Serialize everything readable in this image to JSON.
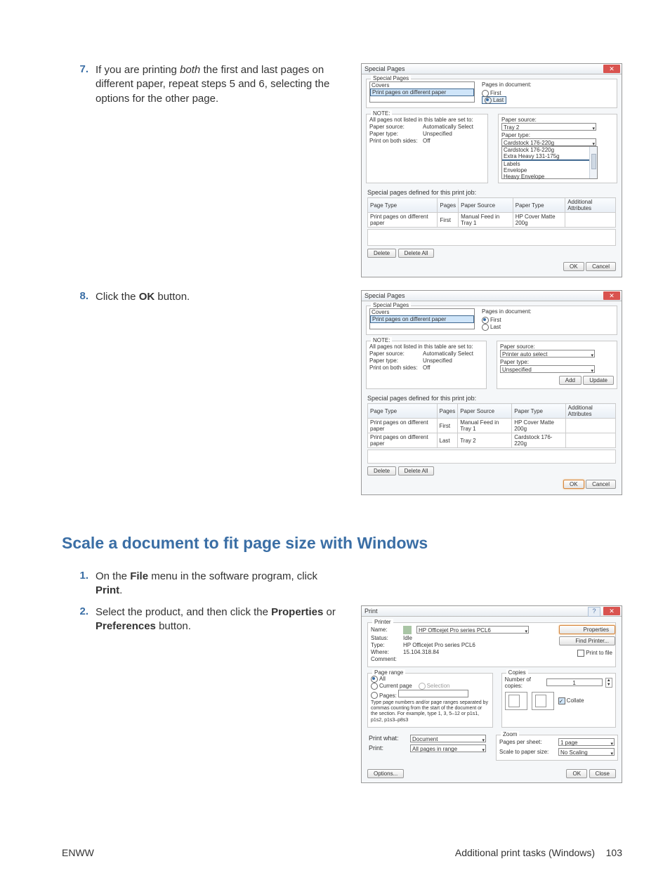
{
  "step7": {
    "num": "7.",
    "text_pre": "If you are printing ",
    "text_em": "both",
    "text_post": " the first and last pages on different paper, repeat steps 5 and 6, selecting the options for the other page."
  },
  "step8": {
    "num": "8.",
    "text_pre": "Click the ",
    "bold": "OK",
    "text_post": " button."
  },
  "section_title": "Scale a document to fit page size with Windows",
  "step1": {
    "num": "1.",
    "p1_pre": "On the ",
    "p1_b1": "File",
    "p1_mid": " menu in the software program, click ",
    "p1_b2": "Print",
    "p1_post": "."
  },
  "step2": {
    "num": "2.",
    "p_pre": "Select the product, and then click the ",
    "p_b1": "Properties",
    "p_mid": " or ",
    "p_b2": "Preferences",
    "p_post": " button."
  },
  "footer_left": "ENWW",
  "footer_right_text": "Additional print tasks (Windows)",
  "footer_page": "103",
  "dlg7": {
    "title": "Special Pages",
    "group": "Special Pages",
    "item_covers": "Covers",
    "item_ppdp": "Print pages on different paper",
    "pg_in_doc": "Pages in document:",
    "first": "First",
    "last": "Last",
    "note_grp": "NOTE:",
    "note_txt": "All pages not listed in this table are set to:",
    "paper_source": "Paper source:",
    "paper_source_v": "Automatically Select",
    "paper_type": "Paper type:",
    "paper_type_v": "Unspecified",
    "both_sides": "Print on both sides:",
    "both_sides_v": "Off",
    "src_lbl": "Paper source:",
    "src_val": "Tray 2",
    "type_lbl": "Paper type:",
    "type_opts": [
      "Cardstock 176-220g",
      "Extra Heavy 131-175g",
      "",
      "Labels",
      "Envelope",
      "Heavy Envelope"
    ],
    "defined_for": "Special pages defined for this print job:",
    "cols": [
      "Page Type",
      "Pages",
      "Paper Source",
      "Paper Type",
      "Additional Attributes"
    ],
    "rows": [
      [
        "Print pages on different paper",
        "First",
        "Manual Feed in Tray 1",
        "HP Cover Matte 200g",
        ""
      ]
    ],
    "delete": "Delete",
    "delete_all": "Delete All",
    "ok": "OK",
    "cancel": "Cancel"
  },
  "dlg8": {
    "title": "Special Pages",
    "group": "Special Pages",
    "item_covers": "Covers",
    "item_ppdp": "Print pages on different paper",
    "pg_in_doc": "Pages in document:",
    "first": "First",
    "last": "Last",
    "note_grp": "NOTE:",
    "note_txt": "All pages not listed in this table are set to:",
    "paper_source": "Paper source:",
    "paper_source_v": "Automatically Select",
    "paper_type": "Paper type:",
    "paper_type_v": "Unspecified",
    "both_sides": "Print on both sides:",
    "both_sides_v": "Off",
    "src_lbl": "Paper source:",
    "src_val": "Printer auto select",
    "type_lbl": "Paper type:",
    "type_val": "Unspecified",
    "add": "Add",
    "update": "Update",
    "defined_for": "Special pages defined for this print job:",
    "cols": [
      "Page Type",
      "Pages",
      "Paper Source",
      "Paper Type",
      "Additional Attributes"
    ],
    "rows": [
      [
        "Print pages on different paper",
        "First",
        "Manual Feed in Tray 1",
        "HP Cover Matte 200g",
        ""
      ],
      [
        "Print pages on different paper",
        "Last",
        "Tray 2",
        "Cardstock 176-220g",
        ""
      ]
    ],
    "delete": "Delete",
    "delete_all": "Delete All",
    "ok": "OK",
    "cancel": "Cancel"
  },
  "dlgPrint": {
    "title": "Print",
    "printer_grp": "Printer",
    "name_lbl": "Name:",
    "name_val": "HP Officejet Pro      series PCL6",
    "status_lbl": "Status:",
    "status_val": "Idle",
    "type_lbl": "Type:",
    "type_val": "HP Officejet Pro      series PCL6",
    "where_lbl": "Where:",
    "where_val": "15.104.318.84",
    "comment_lbl": "Comment:",
    "properties": "Properties",
    "find_printer": "Find Printer...",
    "print_to_file": "Print to file",
    "page_range_grp": "Page range",
    "all": "All",
    "current": "Current page",
    "selection": "Selection",
    "pages": "Pages:",
    "pages_help": "Type page numbers and/or page ranges separated by commas counting from the start of the document or the section. For example, type 1, 3, 5–12 or p1s1, p1s2, p1s3–p8s3",
    "copies_grp": "Copies",
    "num_copies_lbl": "Number of copies:",
    "num_copies_val": "1",
    "collate": "Collate",
    "print_what_lbl": "Print what:",
    "print_what_val": "Document",
    "print_lbl": "Print:",
    "print_val": "All pages in range",
    "zoom_grp": "Zoom",
    "pps_lbl": "Pages per sheet:",
    "pps_val": "1 page",
    "scale_lbl": "Scale to paper size:",
    "scale_val": "No Scaling",
    "options": "Options...",
    "ok": "OK",
    "close": "Close"
  }
}
